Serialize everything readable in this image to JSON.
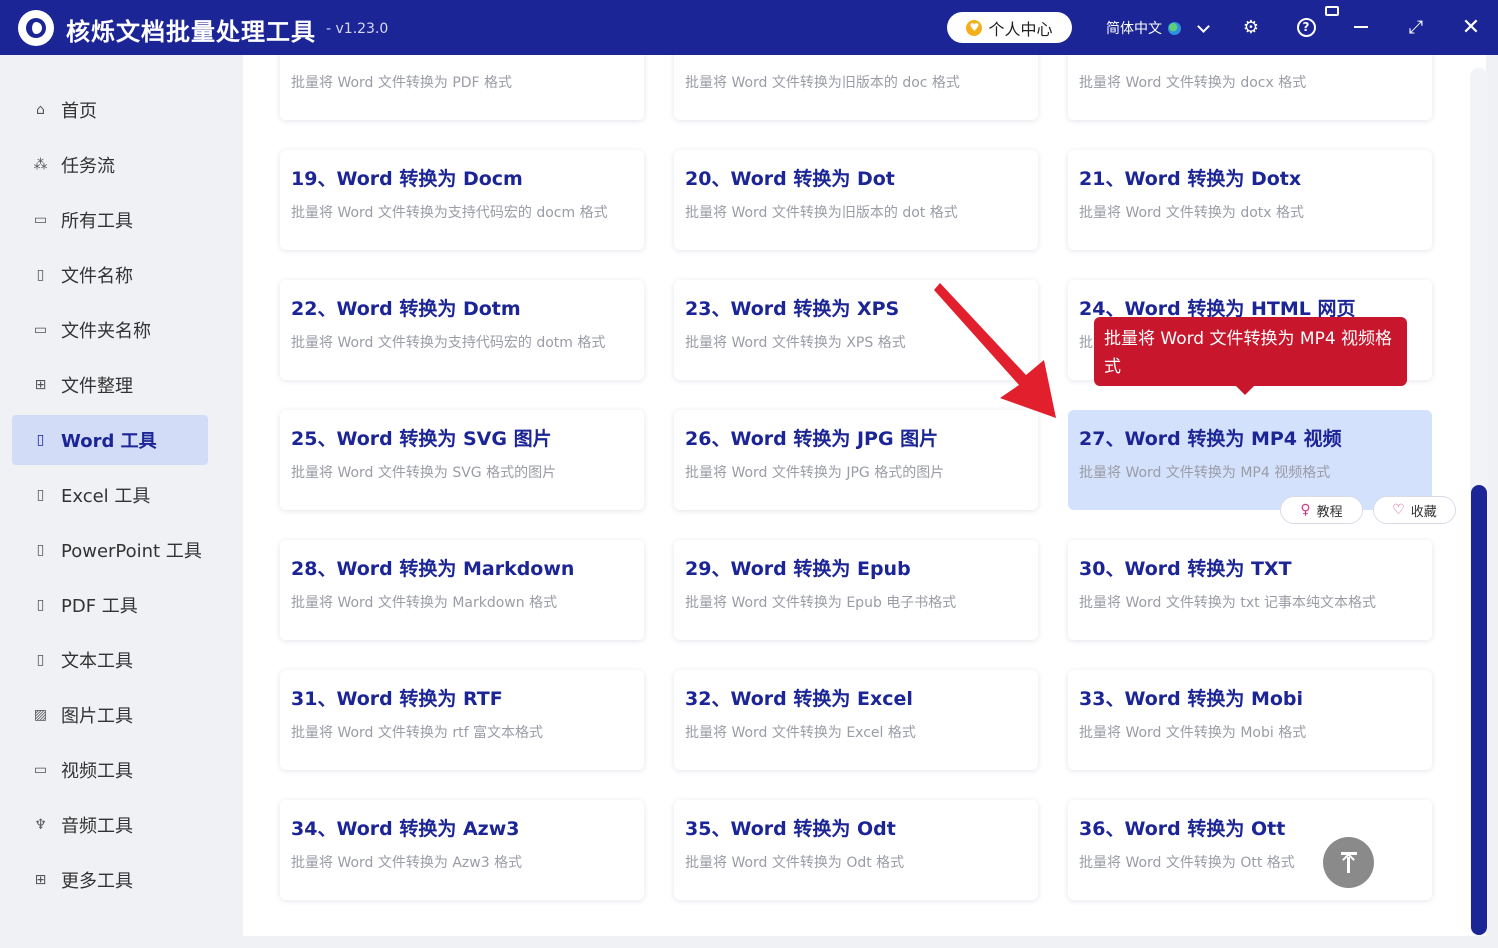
{
  "app": {
    "title": "核烁文档批量处理工具",
    "version": "- v1.23.0",
    "user_center": "个人中心",
    "language": "简体中文",
    "accent": "#1c2596"
  },
  "sidebar": {
    "items": [
      {
        "label": "首页",
        "icon": "home-icon"
      },
      {
        "label": "任务流",
        "icon": "workflow-icon"
      },
      {
        "label": "所有工具",
        "icon": "monitor-icon"
      },
      {
        "label": "文件名称",
        "icon": "file-name-icon"
      },
      {
        "label": "文件夹名称",
        "icon": "folder-icon"
      },
      {
        "label": "文件整理",
        "icon": "organize-icon"
      },
      {
        "label": "Word 工具",
        "icon": "word-file-icon",
        "active": true
      },
      {
        "label": "Excel 工具",
        "icon": "excel-file-icon"
      },
      {
        "label": "PowerPoint 工具",
        "icon": "ppt-file-icon"
      },
      {
        "label": "PDF 工具",
        "icon": "pdf-file-icon"
      },
      {
        "label": "文本工具",
        "icon": "text-file-icon"
      },
      {
        "label": "图片工具",
        "icon": "image-icon"
      },
      {
        "label": "视频工具",
        "icon": "video-icon"
      },
      {
        "label": "音频工具",
        "icon": "microphone-icon"
      },
      {
        "label": "更多工具",
        "icon": "grid-icon"
      }
    ]
  },
  "top_row": [
    {
      "desc": "批量将 Word 文件转换为 PDF 格式"
    },
    {
      "desc": "批量将 Word 文件转换为旧版本的 doc 格式"
    },
    {
      "desc": "批量将 Word 文件转换为 docx 格式"
    }
  ],
  "cards": [
    {
      "title": "19、Word 转换为 Docm",
      "desc": "批量将 Word 文件转换为支持代码宏的 docm 格式"
    },
    {
      "title": "20、Word 转换为 Dot",
      "desc": "批量将 Word 文件转换为旧版本的 dot 格式"
    },
    {
      "title": "21、Word 转换为 Dotx",
      "desc": "批量将 Word 文件转换为 dotx 格式"
    },
    {
      "title": "22、Word 转换为 Dotm",
      "desc": "批量将 Word 文件转换为支持代码宏的 dotm 格式"
    },
    {
      "title": "23、Word 转换为 XPS",
      "desc": "批量将 Word 文件转换为 XPS 格式"
    },
    {
      "title": "24、Word 转换为 HTML 网页",
      "desc": "批…"
    },
    {
      "title": "25、Word 转换为 SVG 图片",
      "desc": "批量将 Word 文件转换为 SVG 格式的图片"
    },
    {
      "title": "26、Word 转换为 JPG 图片",
      "desc": "批量将 Word 文件转换为 JPG 格式的图片"
    },
    {
      "title": "27、Word 转换为 MP4 视频",
      "desc": "批量将 Word 文件转换为 MP4 视频格式",
      "active": true
    },
    {
      "title": "28、Word 转换为 Markdown",
      "desc": "批量将 Word 文件转换为 Markdown 格式"
    },
    {
      "title": "29、Word 转换为 Epub",
      "desc": "批量将 Word 文件转换为 Epub 电子书格式"
    },
    {
      "title": "30、Word 转换为 TXT",
      "desc": "批量将 Word 文件转换为 txt 记事本纯文本格式"
    },
    {
      "title": "31、Word 转换为 RTF",
      "desc": "批量将 Word 文件转换为 rtf 富文本格式"
    },
    {
      "title": "32、Word 转换为 Excel",
      "desc": "批量将 Word 文件转换为 Excel 格式"
    },
    {
      "title": "33、Word 转换为 Mobi",
      "desc": "批量将 Word 文件转换为 Mobi 格式"
    },
    {
      "title": "34、Word 转换为 Azw3",
      "desc": "批量将 Word 文件转换为 Azw3 格式"
    },
    {
      "title": "35、Word 转换为 Odt",
      "desc": "批量将 Word 文件转换为 Odt 格式"
    },
    {
      "title": "36、Word 转换为 Ott",
      "desc": "批量将 Word 文件转换为 Ott 格式"
    }
  ],
  "card_actions": {
    "tutorial": "教程",
    "favorite": "收藏"
  },
  "tooltip": {
    "text": "批量将 Word 文件转换为 MP4 视频格式",
    "color": "#c8162d"
  }
}
